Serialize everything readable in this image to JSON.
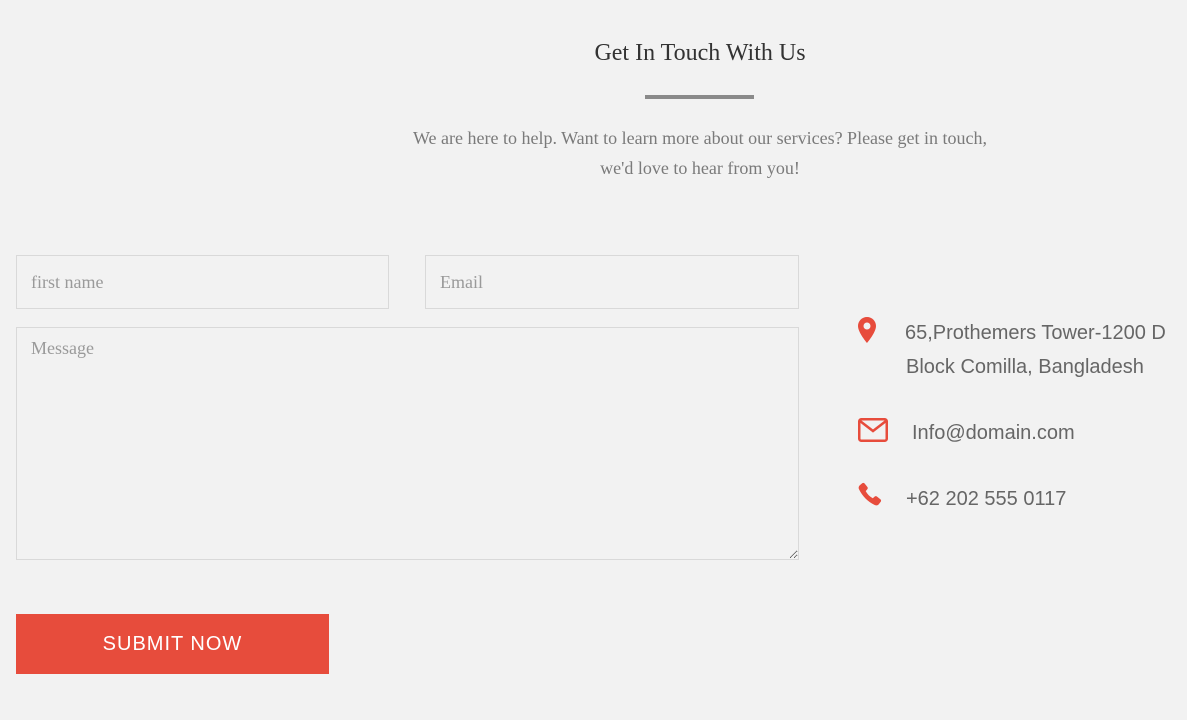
{
  "section": {
    "title": "Get In Touch With Us",
    "intro": "We are here to help. Want to learn more about our services? Please get in touch, we'd love to hear from you!"
  },
  "form": {
    "first_name_placeholder": "first name",
    "email_placeholder": "Email",
    "message_placeholder": "Message",
    "submit_label": "SUBMIT NOW"
  },
  "contact": {
    "address_line1": "65,Prothemers Tower-1200 D",
    "address_line2": "Block Comilla, Bangladesh",
    "email": "Info@domain.com",
    "phone": "+62 202 555 0117",
    "address_icon": "map-marker-icon",
    "email_icon": "envelope-icon",
    "phone_icon": "phone-icon"
  },
  "colors": {
    "accent": "#e74c3c",
    "background": "#f2f2f2"
  }
}
